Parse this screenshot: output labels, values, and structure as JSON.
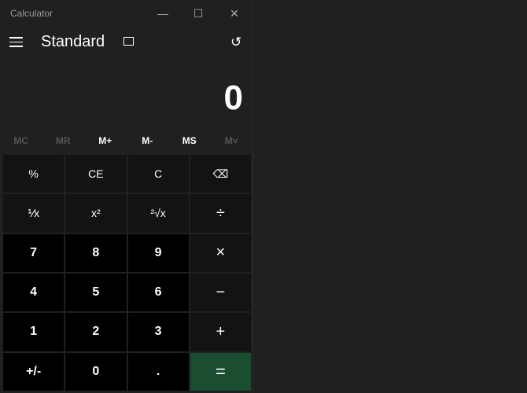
{
  "window": {
    "title": "Calculator"
  },
  "header": {
    "mode": "Standard"
  },
  "display": {
    "value": "0"
  },
  "memory": [
    {
      "label": "MC",
      "enabled": false
    },
    {
      "label": "MR",
      "enabled": false
    },
    {
      "label": "M+",
      "enabled": true
    },
    {
      "label": "M-",
      "enabled": true
    },
    {
      "label": "MS",
      "enabled": true
    },
    {
      "label": "M˅",
      "enabled": false
    }
  ],
  "keys": [
    {
      "label": "%",
      "name": "percent"
    },
    {
      "label": "CE",
      "name": "clear-entry"
    },
    {
      "label": "C",
      "name": "clear"
    },
    {
      "label": "⌫",
      "name": "backspace"
    },
    {
      "label": "⅟x",
      "name": "reciprocal"
    },
    {
      "label": "x²",
      "name": "square"
    },
    {
      "label": "²√x",
      "name": "square-root"
    },
    {
      "label": "÷",
      "name": "divide"
    },
    {
      "label": "7",
      "name": "7"
    },
    {
      "label": "8",
      "name": "8"
    },
    {
      "label": "9",
      "name": "9"
    },
    {
      "label": "×",
      "name": "multiply"
    },
    {
      "label": "4",
      "name": "4"
    },
    {
      "label": "5",
      "name": "5"
    },
    {
      "label": "6",
      "name": "6"
    },
    {
      "label": "−",
      "name": "subtract"
    },
    {
      "label": "1",
      "name": "1"
    },
    {
      "label": "2",
      "name": "2"
    },
    {
      "label": "3",
      "name": "3"
    },
    {
      "label": "+",
      "name": "add"
    },
    {
      "label": "+/-",
      "name": "negate"
    },
    {
      "label": "0",
      "name": "0"
    },
    {
      "label": ".",
      "name": "decimal"
    },
    {
      "label": "=",
      "name": "equals"
    }
  ],
  "colors": {
    "equals": "#1b4e31",
    "number": "#000000",
    "function": "#131313"
  }
}
